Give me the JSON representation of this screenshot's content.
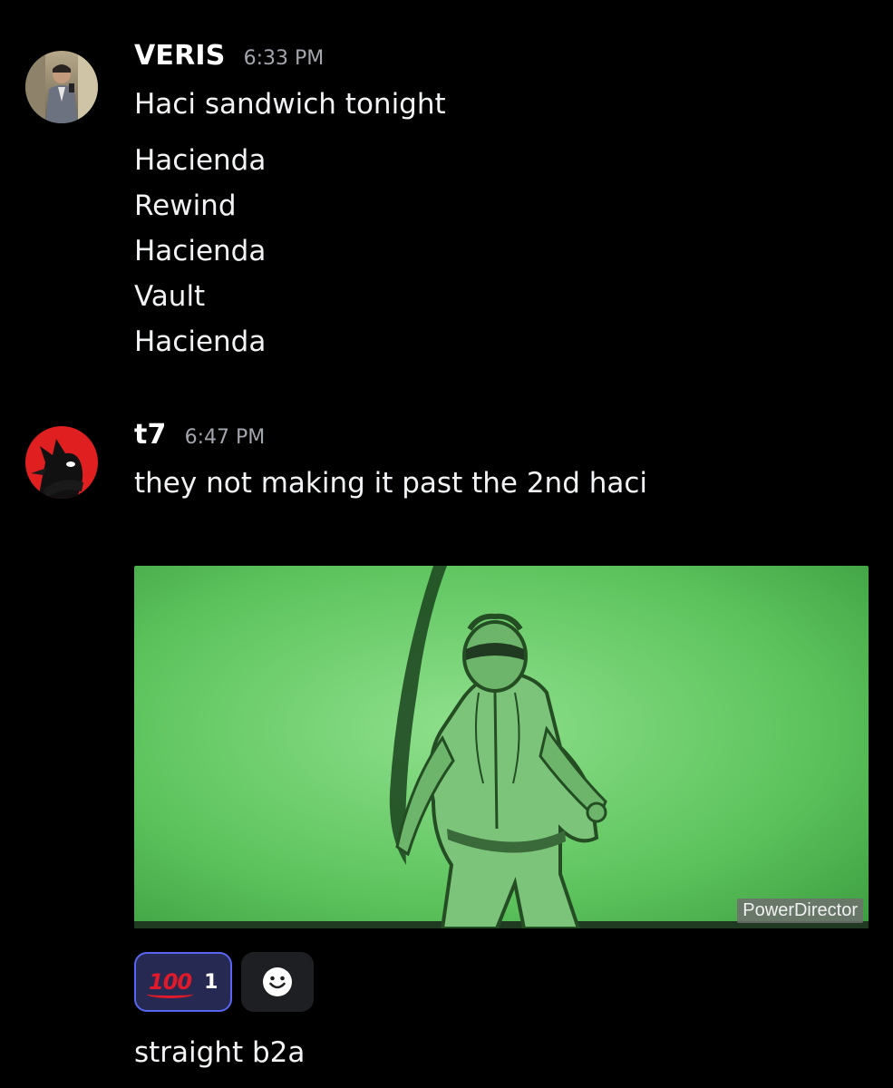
{
  "messages": [
    {
      "username": "VERIS",
      "timestamp": "6:33 PM",
      "lines": [
        "Haci sandwich tonight"
      ],
      "block": [
        "Hacienda",
        "Rewind",
        "Hacienda",
        "Vault",
        "Hacienda"
      ]
    },
    {
      "username": "t7",
      "timestamp": "6:47 PM",
      "lines": [
        "they not making it past the 2nd haci"
      ],
      "attachment": {
        "watermark": "PowerDirector"
      },
      "reactions": [
        {
          "emoji": "100",
          "emoji_name": "hundred-points-icon",
          "count": "1"
        }
      ],
      "followup": "straight b2a"
    }
  ],
  "colors": {
    "background": "#000000",
    "text": "#f2f3f5",
    "timestamp": "#a3a6ad",
    "reaction_border": "#5865f2",
    "reaction_bg": "#262a52"
  }
}
